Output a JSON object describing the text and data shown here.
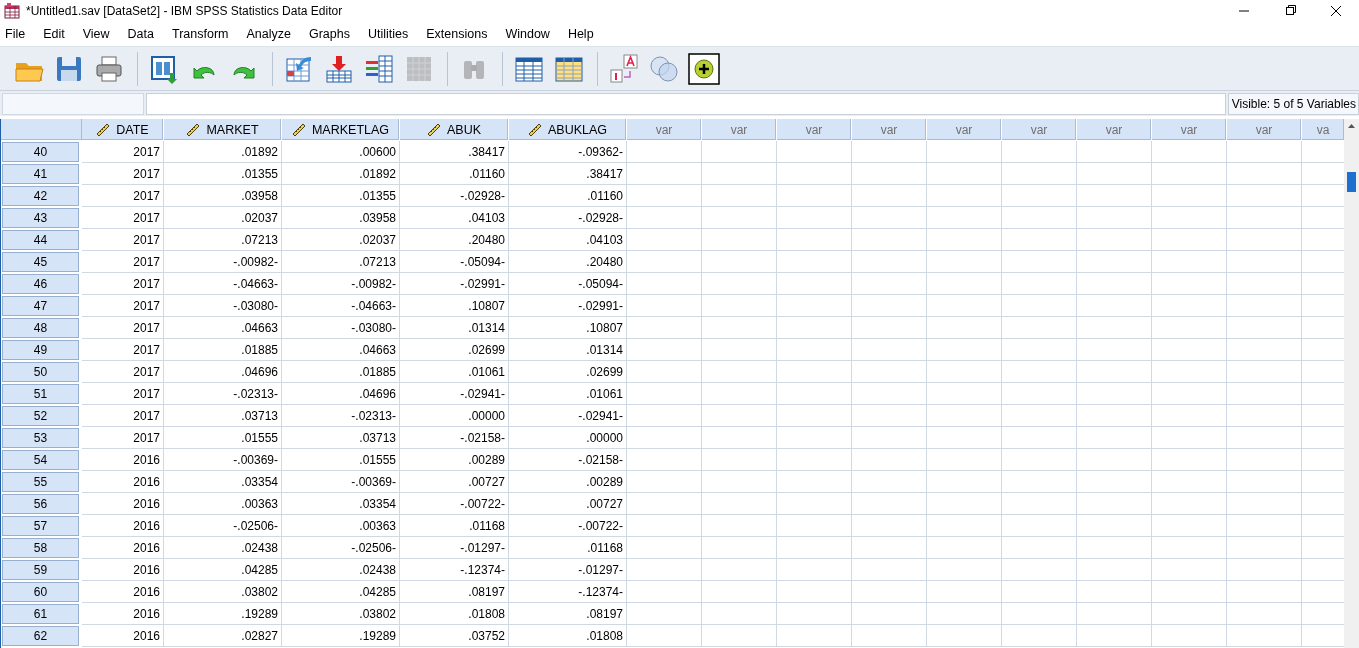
{
  "window": {
    "title": "*Untitled1.sav [DataSet2] - IBM SPSS Statistics Data Editor"
  },
  "menu": [
    "File",
    "Edit",
    "View",
    "Data",
    "Transform",
    "Analyze",
    "Graphs",
    "Utilities",
    "Extensions",
    "Window",
    "Help"
  ],
  "toolbar": [
    [
      {
        "kind": "open",
        "disabled": false
      },
      {
        "kind": "save",
        "disabled": false
      },
      {
        "kind": "print",
        "disabled": false
      }
    ],
    [
      {
        "kind": "recall",
        "disabled": false
      },
      {
        "kind": "undo",
        "disabled": false
      },
      {
        "kind": "redo",
        "disabled": false
      }
    ],
    [
      {
        "kind": "goto",
        "disabled": false
      },
      {
        "kind": "insertcase",
        "disabled": false
      },
      {
        "kind": "insertvar",
        "disabled": false
      },
      {
        "kind": "split",
        "disabled": true
      }
    ],
    [
      {
        "kind": "find",
        "disabled": true
      }
    ],
    [
      {
        "kind": "table",
        "disabled": false
      },
      {
        "kind": "tableyellow",
        "disabled": false
      }
    ],
    [
      {
        "kind": "labels",
        "disabled": false
      },
      {
        "kind": "sets",
        "disabled": false
      },
      {
        "kind": "add",
        "disabled": false
      }
    ]
  ],
  "cell_editor": {
    "visible_status": "Visible: 5 of 5 Variables"
  },
  "table": {
    "columns": [
      {
        "name": "DATE",
        "kind": "variable"
      },
      {
        "name": "MARKET",
        "kind": "variable"
      },
      {
        "name": "MARKETLAG",
        "kind": "variable"
      },
      {
        "name": "ABUK",
        "kind": "variable"
      },
      {
        "name": "ABUKLAG",
        "kind": "variable"
      },
      {
        "name": "var",
        "kind": "empty"
      },
      {
        "name": "var",
        "kind": "empty"
      },
      {
        "name": "var",
        "kind": "empty"
      },
      {
        "name": "var",
        "kind": "empty"
      },
      {
        "name": "var",
        "kind": "empty"
      },
      {
        "name": "var",
        "kind": "empty"
      },
      {
        "name": "var",
        "kind": "empty"
      },
      {
        "name": "var",
        "kind": "empty"
      },
      {
        "name": "var",
        "kind": "empty"
      },
      {
        "name": "va",
        "kind": "empty"
      }
    ],
    "rows": [
      {
        "number": "40",
        "cells": [
          "2017",
          ".01892",
          ".00600",
          ".38417",
          "-.09362-"
        ]
      },
      {
        "number": "41",
        "cells": [
          "2017",
          ".01355",
          ".01892",
          ".01160",
          ".38417"
        ]
      },
      {
        "number": "42",
        "cells": [
          "2017",
          ".03958",
          ".01355",
          "-.02928-",
          ".01160"
        ]
      },
      {
        "number": "43",
        "cells": [
          "2017",
          ".02037",
          ".03958",
          ".04103",
          "-.02928-"
        ]
      },
      {
        "number": "44",
        "cells": [
          "2017",
          ".07213",
          ".02037",
          ".20480",
          ".04103"
        ]
      },
      {
        "number": "45",
        "cells": [
          "2017",
          "-.00982-",
          ".07213",
          "-.05094-",
          ".20480"
        ]
      },
      {
        "number": "46",
        "cells": [
          "2017",
          "-.04663-",
          "-.00982-",
          "-.02991-",
          "-.05094-"
        ]
      },
      {
        "number": "47",
        "cells": [
          "2017",
          "-.03080-",
          "-.04663-",
          ".10807",
          "-.02991-"
        ]
      },
      {
        "number": "48",
        "cells": [
          "2017",
          ".04663",
          "-.03080-",
          ".01314",
          ".10807"
        ]
      },
      {
        "number": "49",
        "cells": [
          "2017",
          ".01885",
          ".04663",
          ".02699",
          ".01314"
        ]
      },
      {
        "number": "50",
        "cells": [
          "2017",
          ".04696",
          ".01885",
          ".01061",
          ".02699"
        ]
      },
      {
        "number": "51",
        "cells": [
          "2017",
          "-.02313-",
          ".04696",
          "-.02941-",
          ".01061"
        ]
      },
      {
        "number": "52",
        "cells": [
          "2017",
          ".03713",
          "-.02313-",
          ".00000",
          "-.02941-"
        ]
      },
      {
        "number": "53",
        "cells": [
          "2017",
          ".01555",
          ".03713",
          "-.02158-",
          ".00000"
        ]
      },
      {
        "number": "54",
        "cells": [
          "2016",
          "-.00369-",
          ".01555",
          ".00289",
          "-.02158-"
        ]
      },
      {
        "number": "55",
        "cells": [
          "2016",
          ".03354",
          "-.00369-",
          ".00727",
          ".00289"
        ]
      },
      {
        "number": "56",
        "cells": [
          "2016",
          ".00363",
          ".03354",
          "-.00722-",
          ".00727"
        ]
      },
      {
        "number": "57",
        "cells": [
          "2016",
          "-.02506-",
          ".00363",
          ".01168",
          "-.00722-"
        ]
      },
      {
        "number": "58",
        "cells": [
          "2016",
          ".02438",
          "-.02506-",
          "-.01297-",
          ".01168"
        ]
      },
      {
        "number": "59",
        "cells": [
          "2016",
          ".04285",
          ".02438",
          "-.12374-",
          "-.01297-"
        ]
      },
      {
        "number": "60",
        "cells": [
          "2016",
          ".03802",
          ".04285",
          ".08197",
          "-.12374-"
        ]
      },
      {
        "number": "61",
        "cells": [
          "2016",
          ".19289",
          ".03802",
          ".01808",
          ".08197"
        ]
      },
      {
        "number": "62",
        "cells": [
          "2016",
          ".02827",
          ".19289",
          ".03752",
          ".01808"
        ]
      }
    ]
  }
}
